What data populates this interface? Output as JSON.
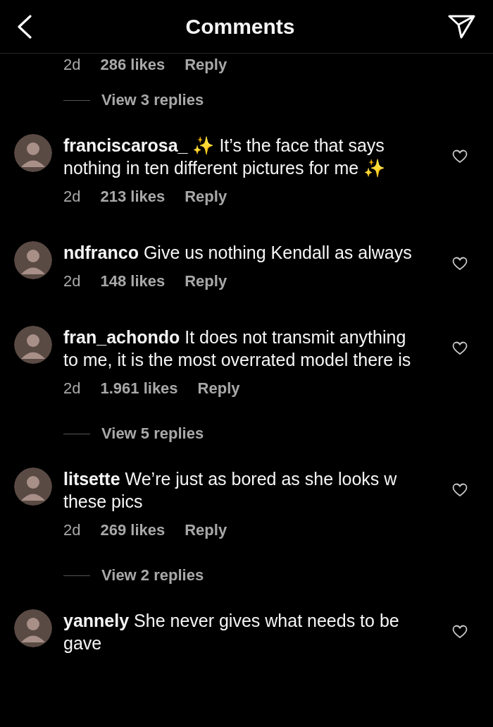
{
  "header": {
    "title": "Comments"
  },
  "partial_meta": {
    "time": "2d",
    "likes": "286 likes",
    "reply": "Reply"
  },
  "items": [
    {
      "kind": "replies",
      "label": "View 3 replies"
    },
    {
      "kind": "comment",
      "username": "franciscarosa_",
      "text": "✨ It’s the face that says nothing in ten different pictures for me ✨",
      "time": "2d",
      "likes": "213 likes",
      "reply": "Reply"
    },
    {
      "kind": "comment",
      "username": "ndfranco",
      "text": "Give us nothing Kendall as always",
      "time": "2d",
      "likes": "148 likes",
      "reply": "Reply"
    },
    {
      "kind": "comment",
      "username": "fran_achondo",
      "text": "It does not transmit anything to me, it is the most overrated model there is",
      "time": "2d",
      "likes": "1.961 likes",
      "reply": "Reply"
    },
    {
      "kind": "replies",
      "label": "View 5 replies"
    },
    {
      "kind": "comment",
      "username": "litsette",
      "text": "We’re just as bored as she looks w these pics",
      "time": "2d",
      "likes": "269 likes",
      "reply": "Reply"
    },
    {
      "kind": "replies",
      "label": "View 2 replies"
    },
    {
      "kind": "comment",
      "username": "yannely",
      "text": "She never gives what needs to be gave"
    }
  ]
}
